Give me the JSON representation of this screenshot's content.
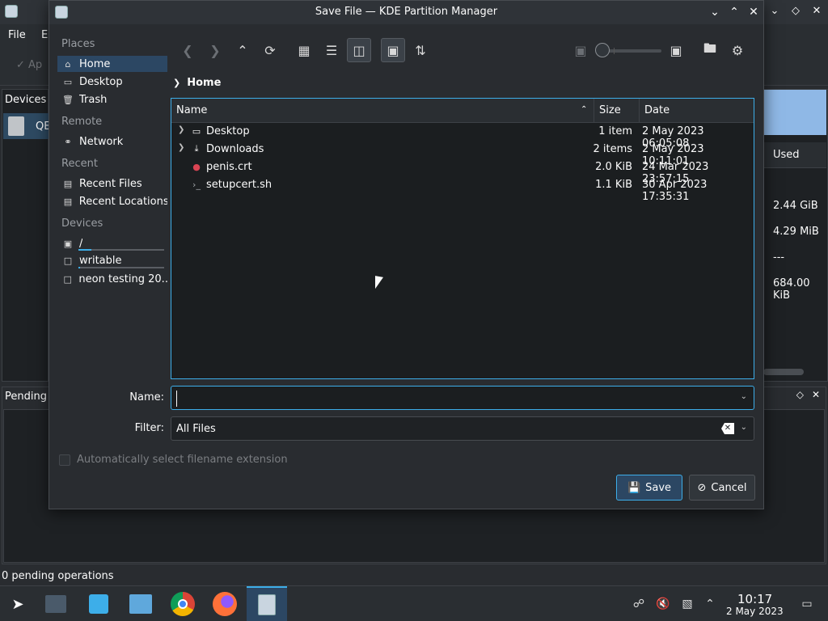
{
  "background_app": {
    "menu": [
      "File",
      "E"
    ],
    "apply_label": "Ap",
    "devices_title": "Devices",
    "device_item": "QE",
    "used_header": "Used",
    "used_values": [
      "2.44 GiB",
      "4.29 MiB",
      "---",
      "684.00 KiB"
    ],
    "pending_title": "Pending",
    "status": "0 pending operations"
  },
  "dialog": {
    "title": "Save File — KDE Partition Manager",
    "places": {
      "sections": [
        "Places",
        "Remote",
        "Recent",
        "Devices"
      ],
      "items": {
        "home": "Home",
        "desktop": "Desktop",
        "trash": "Trash",
        "network": "Network",
        "recent_files": "Recent Files",
        "recent_locations": "Recent Locations",
        "root": "/",
        "writable": "writable",
        "neon": "neon testing 20..."
      },
      "capacity": {
        "root": 0.15,
        "writable": 0.02
      }
    },
    "breadcrumb": "Home",
    "columns": {
      "name": "Name",
      "size": "Size",
      "date": "Date"
    },
    "files": [
      {
        "name": "Desktop",
        "size": "1 item",
        "date": "2 May 2023 06:05:08",
        "icon": "folder-icon"
      },
      {
        "name": "Downloads",
        "size": "2 items",
        "date": "2 May 2023 10:11:01",
        "icon": "download-folder-icon"
      },
      {
        "name": "penis.crt",
        "size": "2.0 KiB",
        "date": "24 Mar 2023 23:57:15",
        "icon": "certificate-icon"
      },
      {
        "name": "setupcert.sh",
        "size": "1.1 KiB",
        "date": "30 Apr 2023 17:35:31",
        "icon": "script-icon"
      }
    ],
    "name_label": "Name:",
    "name_value": "",
    "filter_label": "Filter:",
    "filter_value": "All Files",
    "auto_ext_label": "Automatically select filename extension",
    "save_label": "Save",
    "cancel_label": "Cancel"
  },
  "taskbar": {
    "time": "10:17",
    "date": "2 May 2023"
  },
  "colors": {
    "accent": "#3daee9",
    "selection": "#2c4763",
    "window_bg": "#292c30",
    "view_bg": "#1b1e20"
  }
}
